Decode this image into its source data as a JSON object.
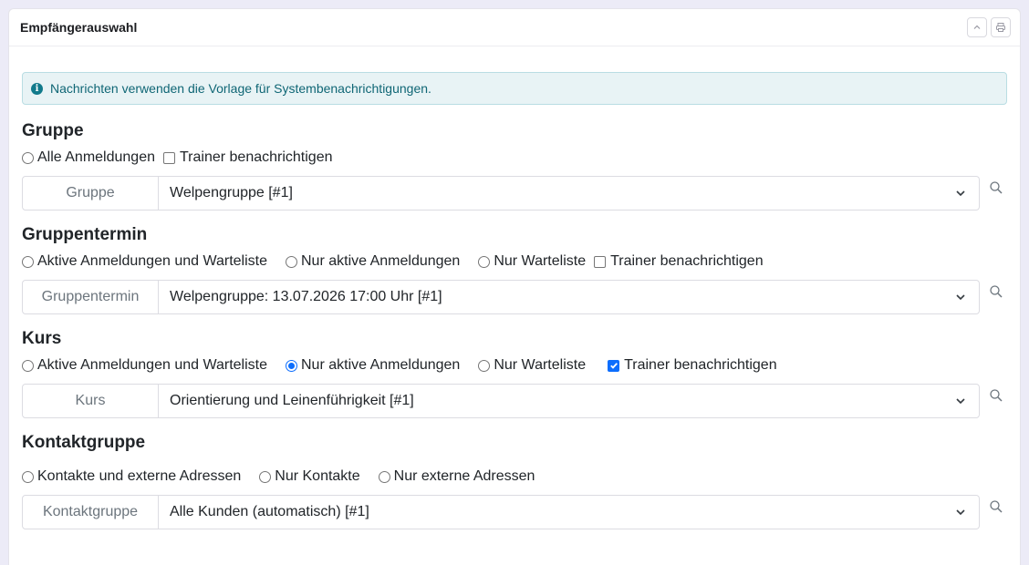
{
  "panel": {
    "title": "Empfängerauswahl",
    "collapse_icon": "chevron-up-icon",
    "print_icon": "printer-icon"
  },
  "alert": {
    "icon": "info-icon",
    "icon_glyph": "i",
    "text": "Nachrichten verwenden die Vorlage für Systembenachrichtigungen."
  },
  "sections": {
    "gruppe": {
      "title": "Gruppe",
      "opt_all": "Alle Anmeldungen",
      "opt_trainer": "Trainer benachrichtigen",
      "addon": "Gruppe",
      "selected": "Welpengruppe [#1]"
    },
    "gruppentermin": {
      "title": "Gruppentermin",
      "opt_active_wait": "Aktive Anmeldungen und Warteliste",
      "opt_active": "Nur aktive Anmeldungen",
      "opt_wait": "Nur Warteliste",
      "opt_trainer": "Trainer benachrichtigen",
      "addon": "Gruppentermin",
      "selected": "Welpengruppe: 13.07.2026 17:00 Uhr [#1]"
    },
    "kurs": {
      "title": "Kurs",
      "opt_active_wait": "Aktive Anmeldungen und Warteliste",
      "opt_active": "Nur aktive Anmeldungen",
      "opt_wait": "Nur Warteliste",
      "opt_trainer": "Trainer benachrichtigen",
      "addon": "Kurs",
      "selected": "Orientierung und Leinenführigkeit [#1]"
    },
    "kontaktgruppe": {
      "title": "Kontaktgruppe",
      "opt_both": "Kontakte und externe Adressen",
      "opt_contacts": "Nur Kontakte",
      "opt_external": "Nur externe Adressen",
      "addon": "Kontaktgruppe",
      "selected": "Alle Kunden (automatisch) [#1]"
    }
  },
  "colors": {
    "accent": "#0d6efd",
    "alert_bg": "#e8f3f5",
    "alert_text": "#0f6675"
  }
}
